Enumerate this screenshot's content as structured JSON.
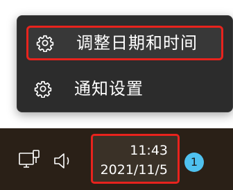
{
  "context_menu": {
    "items": [
      {
        "label": "调整日期和时间",
        "icon": "gear-icon"
      },
      {
        "label": "通知设置",
        "icon": "gear-icon"
      }
    ]
  },
  "taskbar": {
    "clock": {
      "time": "11:43",
      "date": "2021/11/5"
    },
    "notification_badge": "1",
    "icons": [
      "network-icon",
      "volume-icon"
    ]
  },
  "colors": {
    "highlight_border": "#e8231d",
    "menu_background": "#2c2c2c",
    "taskbar_background": "#2a2017",
    "badge": "#4fc1ef"
  }
}
